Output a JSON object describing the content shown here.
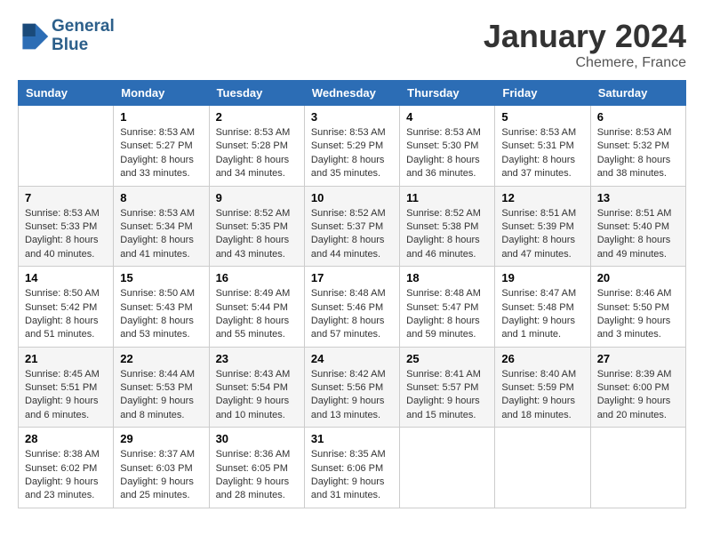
{
  "header": {
    "logo_line1": "General",
    "logo_line2": "Blue",
    "month_year": "January 2024",
    "location": "Chemere, France"
  },
  "columns": [
    "Sunday",
    "Monday",
    "Tuesday",
    "Wednesday",
    "Thursday",
    "Friday",
    "Saturday"
  ],
  "weeks": [
    [
      {
        "day": "",
        "text": ""
      },
      {
        "day": "1",
        "text": "Sunrise: 8:53 AM\nSunset: 5:27 PM\nDaylight: 8 hours\nand 33 minutes."
      },
      {
        "day": "2",
        "text": "Sunrise: 8:53 AM\nSunset: 5:28 PM\nDaylight: 8 hours\nand 34 minutes."
      },
      {
        "day": "3",
        "text": "Sunrise: 8:53 AM\nSunset: 5:29 PM\nDaylight: 8 hours\nand 35 minutes."
      },
      {
        "day": "4",
        "text": "Sunrise: 8:53 AM\nSunset: 5:30 PM\nDaylight: 8 hours\nand 36 minutes."
      },
      {
        "day": "5",
        "text": "Sunrise: 8:53 AM\nSunset: 5:31 PM\nDaylight: 8 hours\nand 37 minutes."
      },
      {
        "day": "6",
        "text": "Sunrise: 8:53 AM\nSunset: 5:32 PM\nDaylight: 8 hours\nand 38 minutes."
      }
    ],
    [
      {
        "day": "7",
        "text": "Sunrise: 8:53 AM\nSunset: 5:33 PM\nDaylight: 8 hours\nand 40 minutes."
      },
      {
        "day": "8",
        "text": "Sunrise: 8:53 AM\nSunset: 5:34 PM\nDaylight: 8 hours\nand 41 minutes."
      },
      {
        "day": "9",
        "text": "Sunrise: 8:52 AM\nSunset: 5:35 PM\nDaylight: 8 hours\nand 43 minutes."
      },
      {
        "day": "10",
        "text": "Sunrise: 8:52 AM\nSunset: 5:37 PM\nDaylight: 8 hours\nand 44 minutes."
      },
      {
        "day": "11",
        "text": "Sunrise: 8:52 AM\nSunset: 5:38 PM\nDaylight: 8 hours\nand 46 minutes."
      },
      {
        "day": "12",
        "text": "Sunrise: 8:51 AM\nSunset: 5:39 PM\nDaylight: 8 hours\nand 47 minutes."
      },
      {
        "day": "13",
        "text": "Sunrise: 8:51 AM\nSunset: 5:40 PM\nDaylight: 8 hours\nand 49 minutes."
      }
    ],
    [
      {
        "day": "14",
        "text": "Sunrise: 8:50 AM\nSunset: 5:42 PM\nDaylight: 8 hours\nand 51 minutes."
      },
      {
        "day": "15",
        "text": "Sunrise: 8:50 AM\nSunset: 5:43 PM\nDaylight: 8 hours\nand 53 minutes."
      },
      {
        "day": "16",
        "text": "Sunrise: 8:49 AM\nSunset: 5:44 PM\nDaylight: 8 hours\nand 55 minutes."
      },
      {
        "day": "17",
        "text": "Sunrise: 8:48 AM\nSunset: 5:46 PM\nDaylight: 8 hours\nand 57 minutes."
      },
      {
        "day": "18",
        "text": "Sunrise: 8:48 AM\nSunset: 5:47 PM\nDaylight: 8 hours\nand 59 minutes."
      },
      {
        "day": "19",
        "text": "Sunrise: 8:47 AM\nSunset: 5:48 PM\nDaylight: 9 hours\nand 1 minute."
      },
      {
        "day": "20",
        "text": "Sunrise: 8:46 AM\nSunset: 5:50 PM\nDaylight: 9 hours\nand 3 minutes."
      }
    ],
    [
      {
        "day": "21",
        "text": "Sunrise: 8:45 AM\nSunset: 5:51 PM\nDaylight: 9 hours\nand 6 minutes."
      },
      {
        "day": "22",
        "text": "Sunrise: 8:44 AM\nSunset: 5:53 PM\nDaylight: 9 hours\nand 8 minutes."
      },
      {
        "day": "23",
        "text": "Sunrise: 8:43 AM\nSunset: 5:54 PM\nDaylight: 9 hours\nand 10 minutes."
      },
      {
        "day": "24",
        "text": "Sunrise: 8:42 AM\nSunset: 5:56 PM\nDaylight: 9 hours\nand 13 minutes."
      },
      {
        "day": "25",
        "text": "Sunrise: 8:41 AM\nSunset: 5:57 PM\nDaylight: 9 hours\nand 15 minutes."
      },
      {
        "day": "26",
        "text": "Sunrise: 8:40 AM\nSunset: 5:59 PM\nDaylight: 9 hours\nand 18 minutes."
      },
      {
        "day": "27",
        "text": "Sunrise: 8:39 AM\nSunset: 6:00 PM\nDaylight: 9 hours\nand 20 minutes."
      }
    ],
    [
      {
        "day": "28",
        "text": "Sunrise: 8:38 AM\nSunset: 6:02 PM\nDaylight: 9 hours\nand 23 minutes."
      },
      {
        "day": "29",
        "text": "Sunrise: 8:37 AM\nSunset: 6:03 PM\nDaylight: 9 hours\nand 25 minutes."
      },
      {
        "day": "30",
        "text": "Sunrise: 8:36 AM\nSunset: 6:05 PM\nDaylight: 9 hours\nand 28 minutes."
      },
      {
        "day": "31",
        "text": "Sunrise: 8:35 AM\nSunset: 6:06 PM\nDaylight: 9 hours\nand 31 minutes."
      },
      {
        "day": "",
        "text": ""
      },
      {
        "day": "",
        "text": ""
      },
      {
        "day": "",
        "text": ""
      }
    ]
  ]
}
